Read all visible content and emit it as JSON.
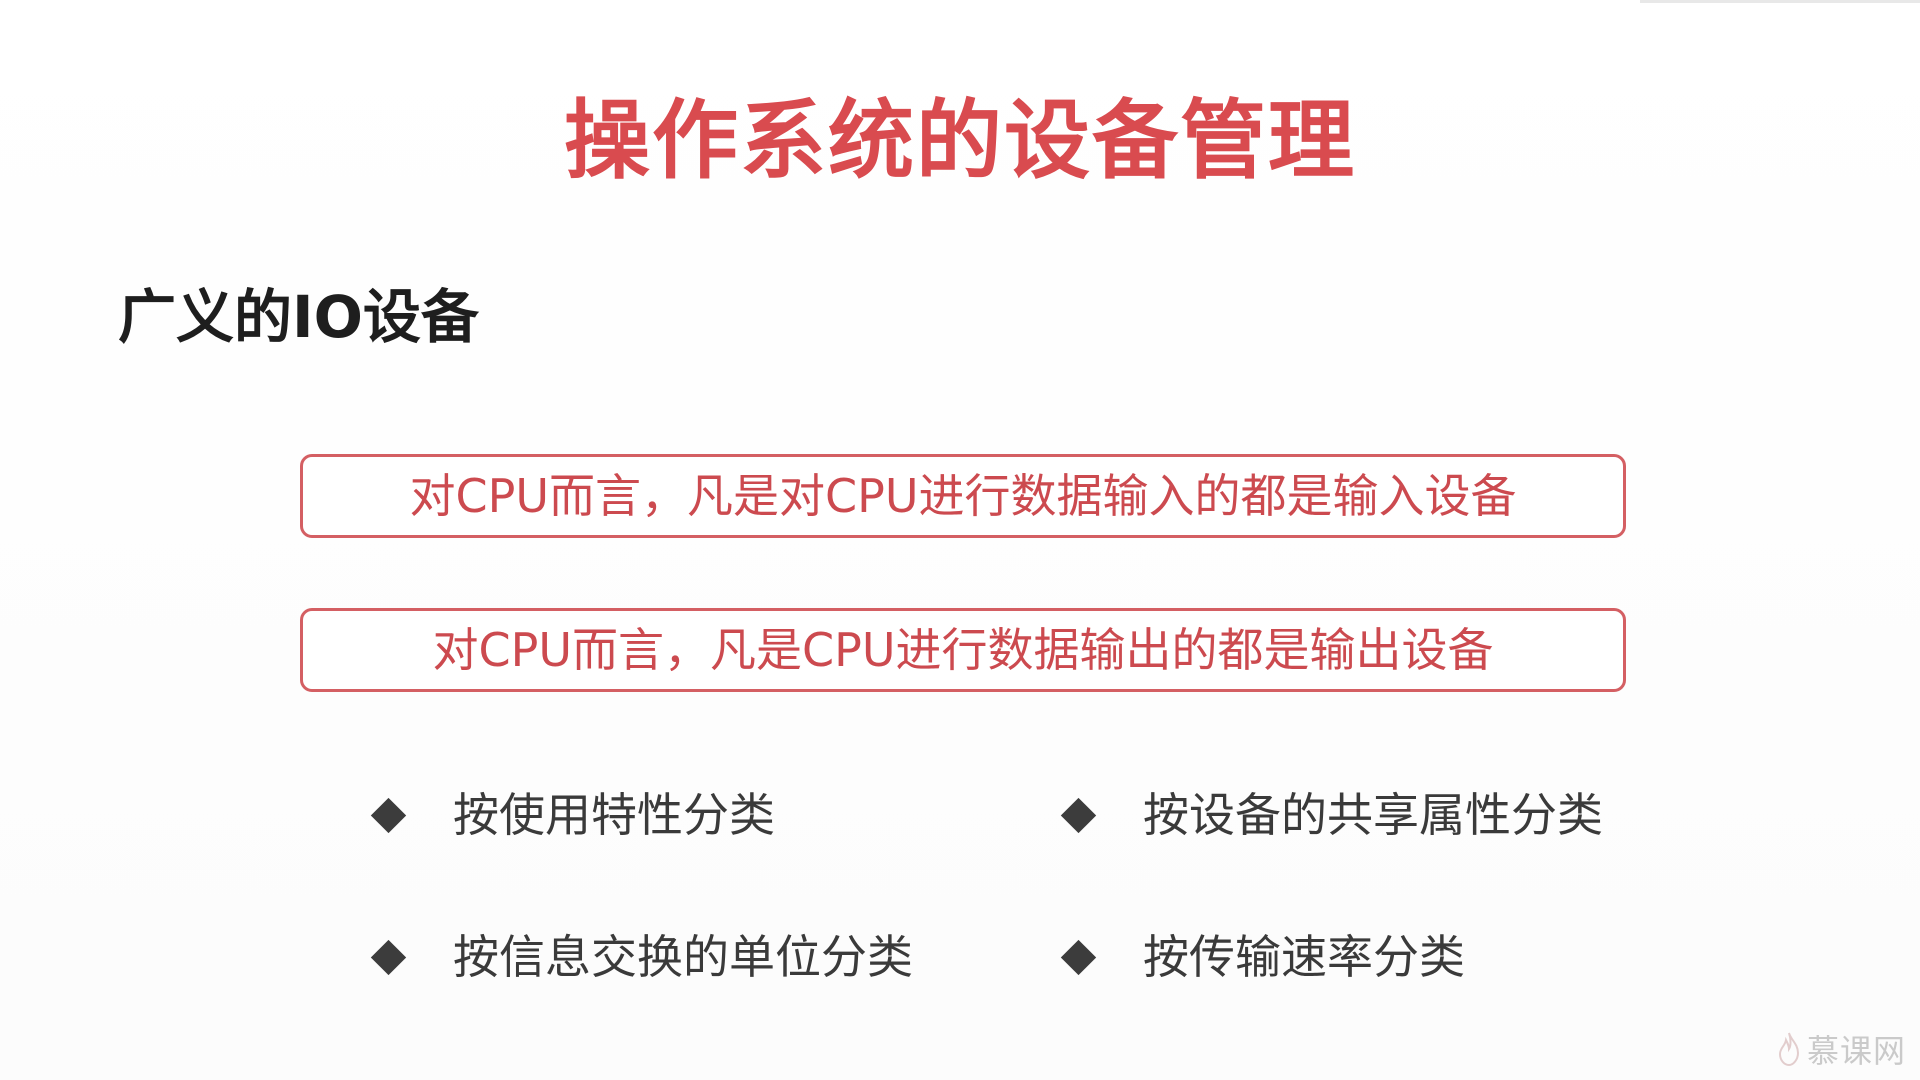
{
  "slide": {
    "title": "操作系统的设备管理",
    "subtitle": "广义的IO设备",
    "definitions": {
      "input": "对CPU而言，凡是对CPU进行数据输入的都是输入设备",
      "output": "对CPU而言，凡是CPU进行数据输出的都是输出设备"
    },
    "bullets": [
      {
        "label": "按使用特性分类"
      },
      {
        "label": "按设备的共享属性分类"
      },
      {
        "label": "按信息交换的单位分类"
      },
      {
        "label": "按传输速率分类"
      }
    ]
  },
  "watermark": {
    "text": "慕课网",
    "logo_icon": "flame-icon"
  },
  "colors": {
    "title": "#d94b4f",
    "box_border": "#d45f63",
    "box_text": "#cc4a4f",
    "body_text": "#3a3a3a",
    "bullet": "#3c3c3c"
  }
}
